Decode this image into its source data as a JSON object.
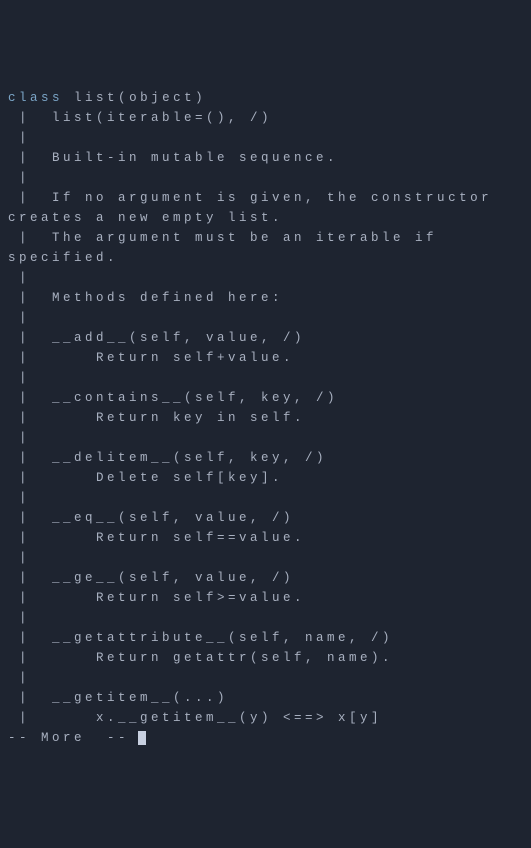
{
  "header": {
    "class_keyword": "class",
    "class_name": "list",
    "base": "object"
  },
  "lines": [
    " |  list(iterable=(), /)",
    " |",
    " |  Built-in mutable sequence.",
    " |",
    " |  If no argument is given, the constructor creates a new empty list.",
    " |  The argument must be an iterable if specified.",
    " |",
    " |  Methods defined here:",
    " |",
    " |  __add__(self, value, /)",
    " |      Return self+value.",
    " |",
    " |  __contains__(self, key, /)",
    " |      Return key in self.",
    " |",
    " |  __delitem__(self, key, /)",
    " |      Delete self[key].",
    " |",
    " |  __eq__(self, value, /)",
    " |      Return self==value.",
    " |",
    " |  __ge__(self, value, /)",
    " |      Return self>=value.",
    " |",
    " |  __getattribute__(self, name, /)",
    " |      Return getattr(self, name).",
    " |",
    " |  __getitem__(...)",
    " |      x.__getitem__(y) <==> x[y]"
  ],
  "more_prompt": "-- More  -- "
}
